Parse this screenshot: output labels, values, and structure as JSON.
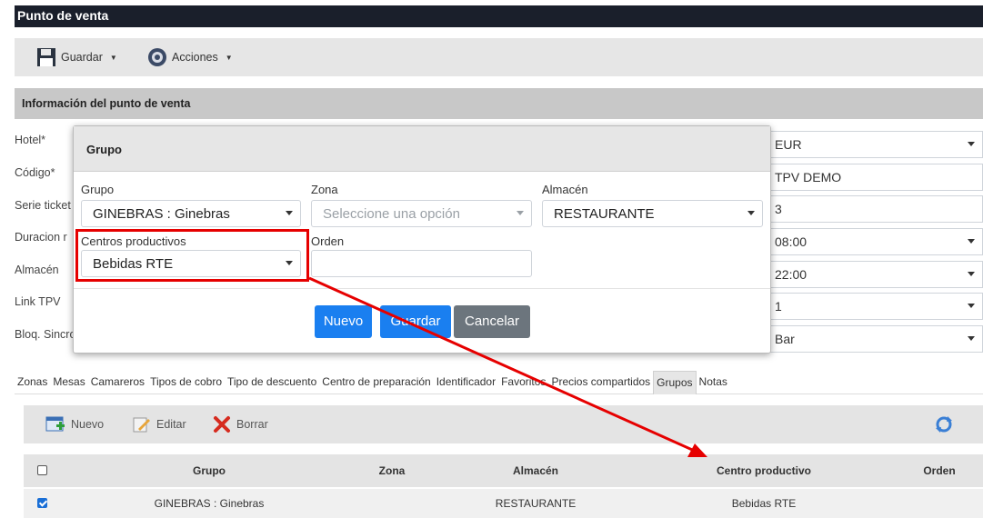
{
  "app": {
    "title": "Punto de venta"
  },
  "toolbar": {
    "save_label": "Guardar",
    "actions_label": "Acciones"
  },
  "section": {
    "title": "Información del punto de venta"
  },
  "form": {
    "labels": [
      "Hotel*",
      "Código*",
      "Serie ticket",
      "Duracion r",
      "Almacén",
      "Link TPV",
      "Bloq. Sincro"
    ],
    "right_values": [
      "EUR",
      "TPV DEMO",
      "3",
      "08:00",
      "22:00",
      "1",
      "Bar"
    ]
  },
  "modal": {
    "title": "Grupo",
    "grupo_label": "Grupo",
    "grupo_value": "GINEBRAS : Ginebras",
    "zona_label": "Zona",
    "zona_placeholder": "Seleccione una opción",
    "almacen_label": "Almacén",
    "almacen_value": "RESTAURANTE",
    "centros_label": "Centros productivos",
    "centros_value": "Bebidas RTE",
    "orden_label": "Orden",
    "orden_value": "",
    "btn_new": "Nuevo",
    "btn_save": "Guardar",
    "btn_cancel": "Cancelar"
  },
  "tabs": [
    "Zonas",
    "Mesas",
    "Camareros",
    "Tipos de cobro",
    "Tipo de descuento",
    "Centro de preparación",
    "Identificador",
    "Favoritos",
    "Precios compartidos",
    "Grupos",
    "Notas"
  ],
  "active_tab": "Grupos",
  "grid_toolbar": {
    "new_label": "Nuevo",
    "edit_label": "Editar",
    "delete_label": "Borrar"
  },
  "grid": {
    "columns": [
      "Grupo",
      "Zona",
      "Almacén",
      "Centro productivo",
      "Orden"
    ],
    "rows": [
      {
        "checked": true,
        "grupo": "GINEBRAS : Ginebras",
        "zona": "",
        "almacen": "RESTAURANTE",
        "centro": "Bebidas RTE",
        "orden": ""
      }
    ]
  },
  "colors": {
    "primary": "#1a7ff0",
    "secondary": "#6c757d",
    "annotation": "#e60000",
    "titlebar": "#1a1f2b"
  }
}
